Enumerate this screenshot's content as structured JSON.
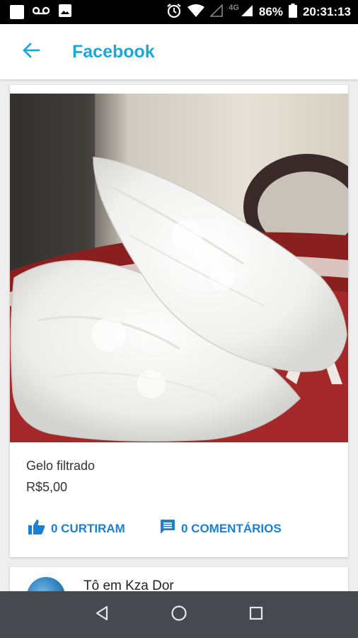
{
  "status_bar": {
    "network": "4G",
    "battery": "86%",
    "time": "20:31:13"
  },
  "app_bar": {
    "title": "Facebook",
    "back_icon": "arrow-back-icon"
  },
  "post": {
    "product_name": "Gelo filtrado",
    "price": "R$5,00",
    "likes_label": "0 CURTIRAM",
    "comments_label": "0 COMENTÁRIOS"
  },
  "next_post": {
    "title": "Tô em Kza Dor"
  },
  "nav_bar": {
    "icons": [
      "back-triangle-icon",
      "home-circle-icon",
      "recents-square-icon"
    ]
  },
  "colors": {
    "accent": "#1ba8d6",
    "action_blue": "#1b7fd6",
    "nav_bg": "#46494d"
  }
}
